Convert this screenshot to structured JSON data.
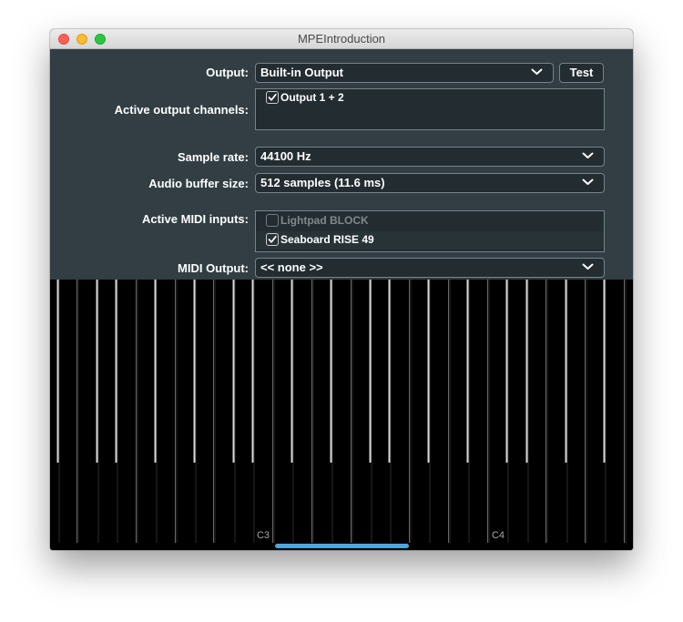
{
  "window": {
    "title": "MPEIntroduction"
  },
  "output": {
    "label": "Output:",
    "value": "Built-in Output",
    "test_label": "Test"
  },
  "active_output_channels": {
    "label": "Active output channels:",
    "items": [
      {
        "label": "Output 1 + 2",
        "checked": true
      }
    ]
  },
  "sample_rate": {
    "label": "Sample rate:",
    "value": "44100 Hz"
  },
  "buffer_size": {
    "label": "Audio buffer size:",
    "value": "512 samples (11.6 ms)"
  },
  "midi_inputs": {
    "label": "Active MIDI inputs:",
    "items": [
      {
        "label": "Lightpad BLOCK",
        "checked": false,
        "enabled": false
      },
      {
        "label": "Seaboard RISE 49",
        "checked": true,
        "enabled": true
      }
    ]
  },
  "midi_output": {
    "label": "MIDI Output:",
    "value": "<< none >>"
  },
  "keyboard": {
    "octave_labels": [
      "C3",
      "C4"
    ]
  },
  "colors": {
    "panel": "#323e44",
    "field": "#222c31",
    "scrollbar_thumb": "#4aa6de"
  },
  "icons": {
    "dropdown": "chevron-down-icon",
    "check": "checkmark-icon"
  }
}
